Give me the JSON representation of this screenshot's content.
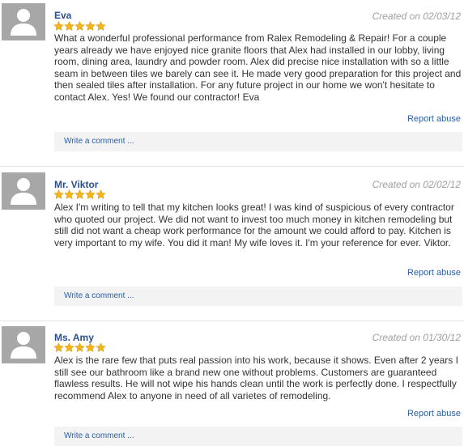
{
  "reviews": [
    {
      "name": "Eva",
      "date": "Created on 02/03/12",
      "rating": 5,
      "text": "What a wonderful professional performance from Ralex Remodeling & Repair! For a couple years already we have enjoyed nice granite floors that Alex had installed in our lobby, living room, dining area, laundry and powder room. Alex did precise nice installation with so a little seam in between tiles we barely can see it. He made very good preparation for this project and then sealed tiles after installation. For any future project in our home we won't hesitate to contact Alex. Yes! We found our contractor! Eva",
      "report_label": "Report abuse",
      "comment_label": "Write a comment ..."
    },
    {
      "name": "Mr. Viktor",
      "date": "Created on 02/02/12",
      "rating": 5,
      "text": "Alex I'm writing to tell that my kitchen looks great! I was kind of suspicious of every contractor who quoted our project. We did not want to invest too much money in kitchen remodeling but still did not want a cheap work performance for the amount we could afford to pay. Kitchen is very important to my wife. You did it man! My wife loves it. I'm your reference for ever. Viktor.",
      "report_label": "Report abuse",
      "comment_label": "Write a comment ..."
    },
    {
      "name": "Ms. Amy",
      "date": "Created on 01/30/12",
      "rating": 5,
      "text": "Alex is the rare few that puts real passion into his work, because it shows. Even after 2 years I still see our bathroom like a brand new one without problems. Customers are guaranteed flawless results. He will not wipe his hands clean until the work is perfectly done. I respectfully recommend Alex to anyone in need of all varietes of remodeling.",
      "report_label": "Report abuse",
      "comment_label": "Write a comment ..."
    }
  ],
  "colors": {
    "name": "#2a4f8f",
    "link": "#2a5fa8",
    "date": "#a0a0a0",
    "star": "#f2b51c",
    "avatar_bg": "#a7a7a7",
    "comment_bg": "#f3f3f3"
  },
  "icons": {
    "avatar": "user-silhouette-icon",
    "rating": "star-icon"
  }
}
